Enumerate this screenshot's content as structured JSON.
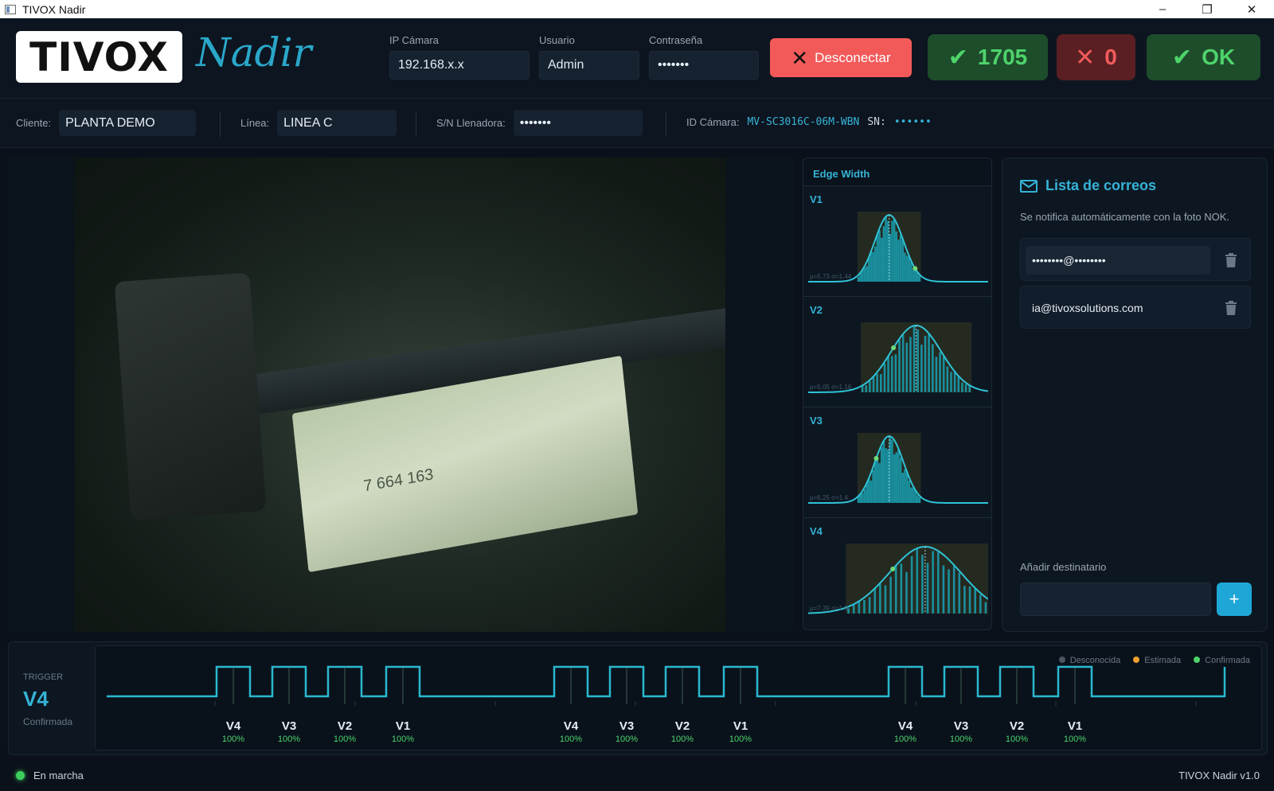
{
  "window": {
    "title": "TIVOX Nadir",
    "controls": [
      "–",
      "❐",
      "✕"
    ]
  },
  "header": {
    "logo": "TIVOX",
    "product": "Nadir",
    "ip_label": "IP Cámara",
    "ip_value": "192.168.x.x",
    "user_label": "Usuario",
    "user_value": "Admin",
    "password_label": "Contraseña",
    "password_value": "•••••••",
    "disconnect_label": "Desconectar",
    "ok_count": "1705",
    "nok_count": "0",
    "status_label": "OK"
  },
  "info": {
    "client_label": "Cliente:",
    "client_value": "PLANTA DEMO",
    "line_label": "Línea:",
    "line_value": "LINEA C",
    "sn_filler_label": "S/N Llenadora:",
    "sn_filler_value": "•••••••",
    "camera_id_label": "ID Cámara:",
    "camera_id_value": "MV-SC3016C-06M-WBN",
    "sn_label": "SN:",
    "sn_value": "••••••"
  },
  "camera": {
    "box_label": "7    664 163"
  },
  "histograms": {
    "title": "Edge Width",
    "items": [
      {
        "label": "V1",
        "stat": "μ=5.73  σ=1.44",
        "center": 0.45,
        "width": 0.08
      },
      {
        "label": "V2",
        "stat": "μ=5.05  σ=1.16",
        "center": 0.6,
        "width": 0.14
      },
      {
        "label": "V3",
        "stat": "μ=6.25  σ=1.4",
        "center": 0.45,
        "width": 0.08
      },
      {
        "label": "V4",
        "stat": "μ=7.39  σ=1.9",
        "center": 0.65,
        "width": 0.2
      }
    ]
  },
  "mail": {
    "title": "Lista de correos",
    "subtitle": "Se notifica automáticamente con la foto NOK.",
    "entries": [
      "••••••••@••••••••",
      "ia@tivoxsolutions.com"
    ],
    "add_label": "Añadir destinatario",
    "add_button": "+"
  },
  "trigger": {
    "label": "TRIGGER",
    "value": "V4",
    "state": "Confirmada",
    "legend": [
      "Desconocida",
      "Estimada",
      "Confirmada"
    ],
    "legend_colors": [
      "#4b5663",
      "#f0a030",
      "#4ed36b"
    ],
    "pulses": [
      {
        "name": "V4",
        "conf": "100%"
      },
      {
        "name": "V3",
        "conf": "100%"
      },
      {
        "name": "V2",
        "conf": "100%"
      },
      {
        "name": "V1",
        "conf": "100%"
      },
      {
        "name": "V4",
        "conf": "100%"
      },
      {
        "name": "V3",
        "conf": "100%"
      },
      {
        "name": "V2",
        "conf": "100%"
      },
      {
        "name": "V1",
        "conf": "100%"
      },
      {
        "name": "V4",
        "conf": "100%"
      },
      {
        "name": "V3",
        "conf": "100%"
      },
      {
        "name": "V2",
        "conf": "100%"
      },
      {
        "name": "V1",
        "conf": "100%"
      }
    ]
  },
  "status": {
    "text": "En marcha",
    "version": "TIVOX Nadir v1.0"
  },
  "colors": {
    "accent": "#35b3d6",
    "ok": "#4ed36b",
    "nok": "#f05b5b"
  }
}
